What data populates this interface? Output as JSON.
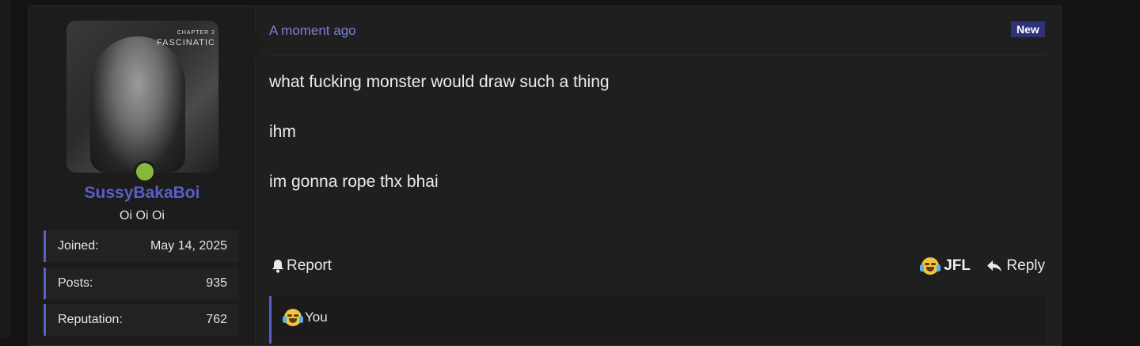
{
  "post": {
    "author": {
      "username": "SussyBakaBoi",
      "title": "Oi Oi Oi",
      "avatar_caption_line1": "CHAPTER 2",
      "avatar_caption_line2": "FASCINATIC",
      "online": true,
      "stats": [
        {
          "label": "Joined:",
          "value": "May 14, 2025"
        },
        {
          "label": "Posts:",
          "value": "935"
        },
        {
          "label": "Reputation:",
          "value": "762"
        }
      ]
    },
    "timestamp": "A moment ago",
    "badge": "New",
    "body": [
      "what fucking monster would draw such a thing",
      "ihm",
      "im gonna rope thx bhai"
    ],
    "actions": {
      "report_label": "Report",
      "reaction_label": "JFL",
      "reply_label": "Reply"
    },
    "reactions": {
      "list_label": "You"
    }
  },
  "colors": {
    "accent": "#5a5ec8",
    "online": "#86b83a",
    "badge_bg": "#2f3277"
  }
}
